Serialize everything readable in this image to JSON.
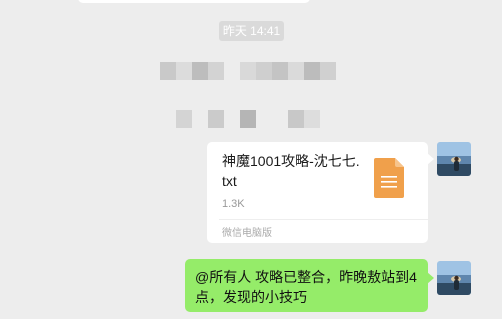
{
  "chat": {
    "timestamp": "昨天 14:41",
    "messages": [
      {
        "type": "file",
        "file_name": "神魔1001攻略-沈七七.txt",
        "file_size": "1.3K",
        "source": "微信电脑版",
        "file_icon": "txt-document-icon"
      },
      {
        "type": "text",
        "text": "@所有人 攻略已整合，昨晚敖站到4点，发现的小技巧"
      }
    ]
  },
  "colors": {
    "chat_background": "#ededed",
    "sent_bubble": "#95ec69",
    "file_bubble": "#ffffff",
    "timestamp_background": "#dadada",
    "file_icon": "#f0a04b"
  }
}
